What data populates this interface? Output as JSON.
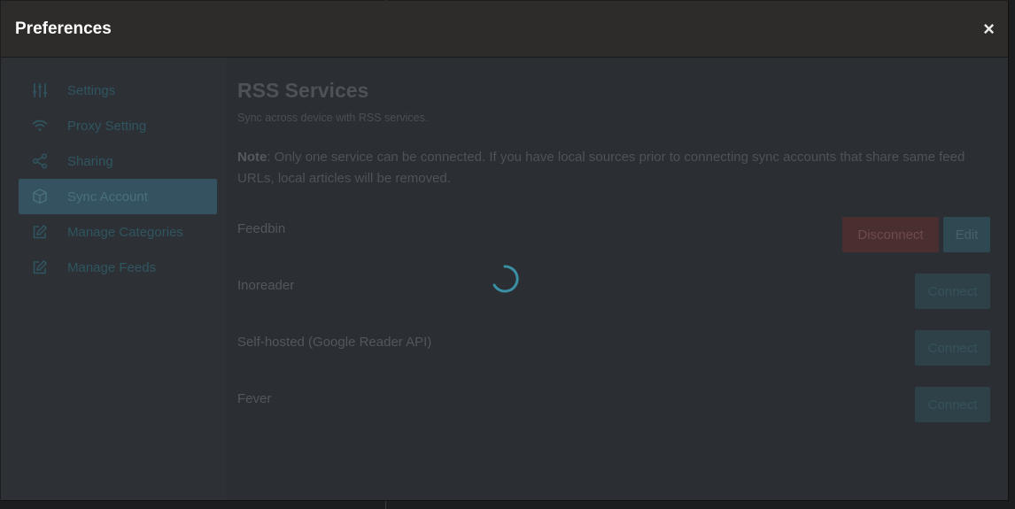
{
  "dialog": {
    "title": "Preferences",
    "close_symbol": "×"
  },
  "sidebar": {
    "items": [
      {
        "label": "Settings",
        "icon": "sliders-icon",
        "active": false
      },
      {
        "label": "Proxy Setting",
        "icon": "wifi-icon",
        "active": false
      },
      {
        "label": "Sharing",
        "icon": "share-icon",
        "active": false
      },
      {
        "label": "Sync Account",
        "icon": "cube-icon",
        "active": true
      },
      {
        "label": "Manage Categories",
        "icon": "edit-icon",
        "active": false
      },
      {
        "label": "Manage Feeds",
        "icon": "edit-icon",
        "active": false
      }
    ]
  },
  "content": {
    "title": "RSS Services",
    "description": "Sync across device with RSS services.",
    "note_label": "Note",
    "note_text": ": Only one service can be connected. If you have local sources prior to connecting sync accounts that share same feed URLs, local articles will be removed.",
    "services": [
      {
        "name": "Feedbin",
        "disconnect_label": "Disconnect",
        "edit_label": "Edit"
      },
      {
        "name": "Inoreader",
        "connect_label": "Connect"
      },
      {
        "name": "Self-hosted (Google Reader API)",
        "connect_label": "Connect"
      },
      {
        "name": "Fever",
        "connect_label": "Connect"
      }
    ]
  },
  "colors": {
    "accent": "#2a8fa6",
    "spinner": "#3b8fa4",
    "danger": "#4a2f31"
  },
  "loading": true
}
